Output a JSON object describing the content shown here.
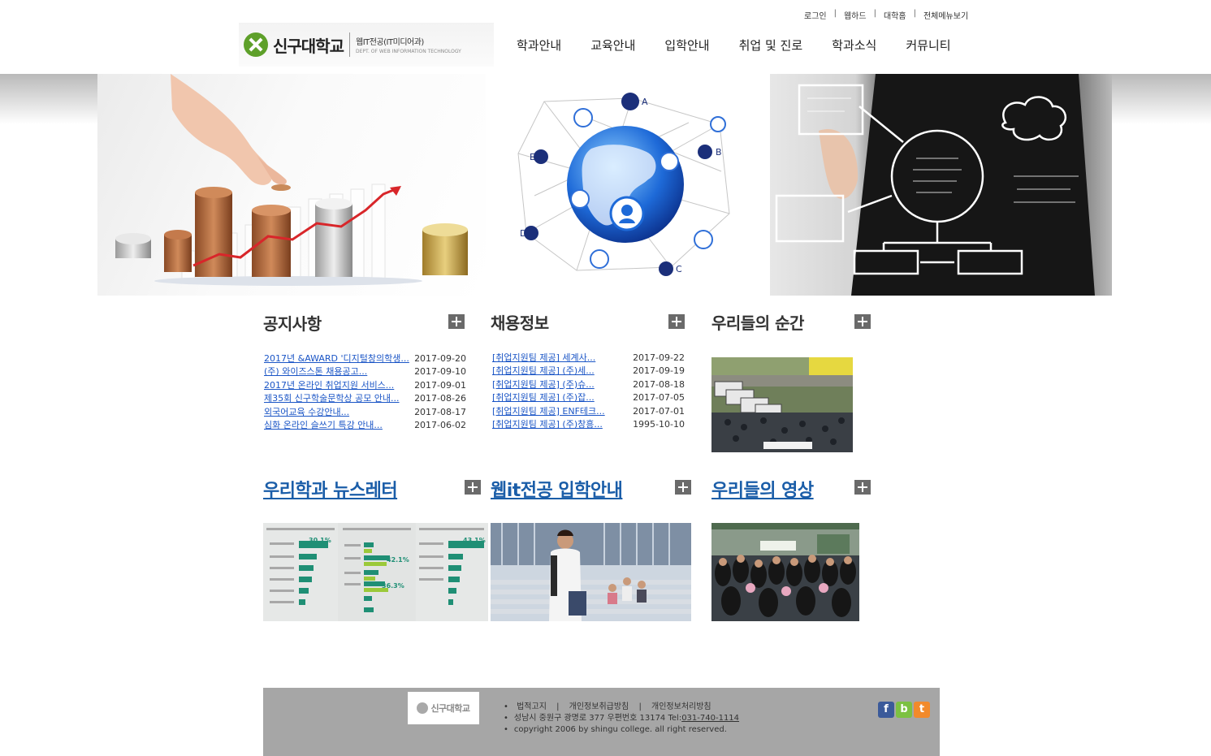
{
  "utility": {
    "login": "로그인",
    "webhard": "웹하드",
    "university_home": "대학홈",
    "sitemap": "전체메뉴보기"
  },
  "logo": {
    "name": "신구대학교",
    "dept_ko": "웹IT전공(IT미디어과)",
    "dept_en": "DEPT. OF WEB INFORMATION TECHNOLOGY"
  },
  "nav": [
    "학과안내",
    "교육안내",
    "입학안내",
    "취업 및 진로",
    "학과소식",
    "커뮤니티"
  ],
  "banner": {
    "globe_labels": [
      "A",
      "B",
      "C",
      "D",
      "E"
    ]
  },
  "notices": {
    "title": "공지사항",
    "items": [
      {
        "title": "2017년 &AWARD '디지털창의학생...",
        "date": "2017-09-20"
      },
      {
        "title": "(주) 와이즈스톤 채용공고...",
        "date": "2017-09-10"
      },
      {
        "title": "2017년 온라인 취업지원 서비스...",
        "date": "2017-09-01"
      },
      {
        "title": "제35회 신구학술문학상 공모 안내...",
        "date": "2017-08-26"
      },
      {
        "title": "외국어교육 수강안내...",
        "date": "2017-08-17"
      },
      {
        "title": "심화 온라인 슬쓰기 특강 안내...",
        "date": "2017-06-02"
      }
    ]
  },
  "jobs": {
    "title": "채용정보",
    "items": [
      {
        "title": "[취업지원팀 제공] 세계사...",
        "date": "2017-09-22"
      },
      {
        "title": "[취업지원팀 제공] (주)세...",
        "date": "2017-09-19"
      },
      {
        "title": "[취업지원팀 제공] (주)슈...",
        "date": "2017-08-18"
      },
      {
        "title": "[취업지원팀 제공] (주)잡...",
        "date": "2017-07-05"
      },
      {
        "title": "[취업지원팀 제공] ENF테크...",
        "date": "2017-07-01"
      },
      {
        "title": "[취업지원팀 제공] (주)창흥...",
        "date": "1995-10-10"
      }
    ]
  },
  "moments": {
    "title": "우리들의 순간"
  },
  "newsletter": {
    "title": "우리학과 뉴스레터",
    "chart_percents": [
      "30.1%",
      "42.1%",
      "36.3%",
      "43.1%"
    ]
  },
  "admission": {
    "title": "웹it전공 입학안내"
  },
  "videos": {
    "title": "우리들의 영상"
  },
  "footer": {
    "logo_text": "신구대학교",
    "links": [
      "법적고지",
      "개인정보취급방침",
      "개인정보처리방침"
    ],
    "address": "성남시 중원구 광명로 377 우편번호 13174 Tel:",
    "tel": "031-740-1114",
    "copyright": "copyright 2006 by shingu college. all right reserved.",
    "social": [
      "f",
      "b",
      "t"
    ]
  },
  "colors": {
    "link": "#1a55c6",
    "title_link": "#1a5da8",
    "footer_bg": "#a6a6a6",
    "logo_green": "#5ea02a"
  }
}
